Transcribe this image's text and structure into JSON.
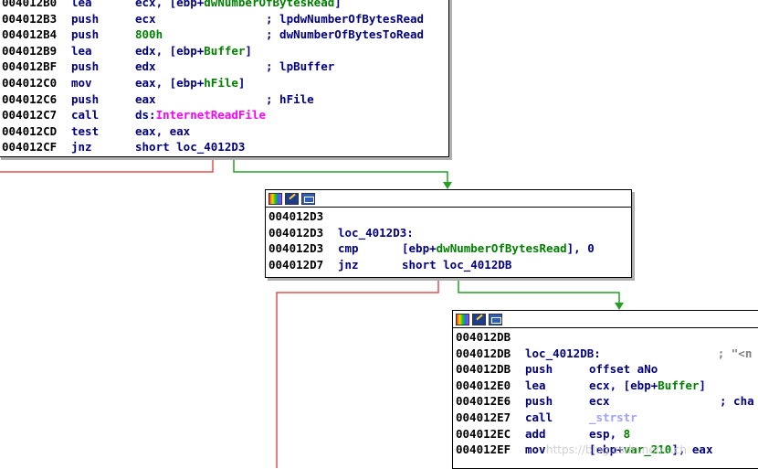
{
  "node1": {
    "lines": [
      {
        "addr": "004012B0",
        "mn": "lea",
        "parts": [
          {
            "t": "ecx, [ebp+",
            "c": "ops"
          },
          {
            "t": "dwNumberOfBytesRead",
            "c": "sym"
          },
          {
            "t": "]",
            "c": "ops"
          }
        ]
      },
      {
        "addr": "004012B3",
        "mn": "push",
        "parts": [
          {
            "t": "ecx",
            "c": "ops"
          },
          {
            "t": "                ; lpdwNumberOfBytesRead",
            "c": "cmt"
          }
        ]
      },
      {
        "addr": "004012B4",
        "mn": "push",
        "parts": [
          {
            "t": "800h",
            "c": "num"
          },
          {
            "t": "               ; dwNumberOfBytesToRead",
            "c": "cmt"
          }
        ]
      },
      {
        "addr": "004012B9",
        "mn": "lea",
        "parts": [
          {
            "t": "edx, [ebp+",
            "c": "ops"
          },
          {
            "t": "Buffer",
            "c": "sym"
          },
          {
            "t": "]",
            "c": "ops"
          }
        ]
      },
      {
        "addr": "004012BF",
        "mn": "push",
        "parts": [
          {
            "t": "edx",
            "c": "ops"
          },
          {
            "t": "                ; lpBuffer",
            "c": "cmt"
          }
        ]
      },
      {
        "addr": "004012C0",
        "mn": "mov",
        "parts": [
          {
            "t": "eax, [ebp+",
            "c": "ops"
          },
          {
            "t": "hFile",
            "c": "sym"
          },
          {
            "t": "]",
            "c": "ops"
          }
        ]
      },
      {
        "addr": "004012C6",
        "mn": "push",
        "parts": [
          {
            "t": "eax",
            "c": "ops"
          },
          {
            "t": "                ; hFile",
            "c": "cmt"
          }
        ]
      },
      {
        "addr": "004012C7",
        "mn": "call",
        "parts": [
          {
            "t": "ds:",
            "c": "ops"
          },
          {
            "t": "InternetReadFile",
            "c": "api"
          }
        ]
      },
      {
        "addr": "004012CD",
        "mn": "test",
        "parts": [
          {
            "t": "eax, eax",
            "c": "ops"
          }
        ]
      },
      {
        "addr": "004012CF",
        "mn": "jnz",
        "parts": [
          {
            "t": "short loc_4012D3",
            "c": "ops"
          }
        ]
      }
    ]
  },
  "node2": {
    "lines": [
      {
        "addr": "004012D3",
        "mn": "",
        "parts": []
      },
      {
        "addr": "004012D3",
        "mn": "",
        "parts": [
          {
            "t": "loc_4012D3:",
            "c": "lbl"
          }
        ]
      },
      {
        "addr": "004012D3",
        "mn": "cmp",
        "parts": [
          {
            "t": "[ebp+",
            "c": "ops"
          },
          {
            "t": "dwNumberOfBytesRead",
            "c": "sym"
          },
          {
            "t": "], 0",
            "c": "ops"
          }
        ]
      },
      {
        "addr": "004012D7",
        "mn": "jnz",
        "parts": [
          {
            "t": "short loc_4012DB",
            "c": "ops"
          }
        ]
      }
    ]
  },
  "node3": {
    "lines": [
      {
        "addr": "004012DB",
        "mn": "",
        "parts": []
      },
      {
        "addr": "004012DB",
        "mn": "",
        "parts": [
          {
            "t": "loc_4012DB:",
            "c": "lbl"
          },
          {
            "t": "                 ; \"<n",
            "c": "str"
          }
        ]
      },
      {
        "addr": "004012DB",
        "mn": "push",
        "parts": [
          {
            "t": "offset aNo",
            "c": "ops"
          }
        ]
      },
      {
        "addr": "004012E0",
        "mn": "lea",
        "parts": [
          {
            "t": "ecx, [ebp+",
            "c": "ops"
          },
          {
            "t": "Buffer",
            "c": "sym"
          },
          {
            "t": "]",
            "c": "ops"
          }
        ]
      },
      {
        "addr": "004012E6",
        "mn": "push",
        "parts": [
          {
            "t": "ecx",
            "c": "ops"
          },
          {
            "t": "                ; cha",
            "c": "cmt"
          }
        ]
      },
      {
        "addr": "004012E7",
        "mn": "call",
        "parts": [
          {
            "t": "_strstr",
            "c": "fn"
          }
        ]
      },
      {
        "addr": "004012EC",
        "mn": "add",
        "parts": [
          {
            "t": "esp, ",
            "c": "ops"
          },
          {
            "t": "8",
            "c": "num"
          }
        ]
      },
      {
        "addr": "004012EF",
        "mn": "mov",
        "parts": [
          {
            "t": "[ebp+",
            "c": "ops"
          },
          {
            "t": "var_210",
            "c": "sym"
          },
          {
            "t": "], eax",
            "c": "ops"
          }
        ]
      }
    ]
  },
  "watermark": "https://blog.csdn.net/...ch",
  "colors": {
    "true_edge": "#00a000",
    "false_edge": "#e02020",
    "node_border": "#000000"
  }
}
